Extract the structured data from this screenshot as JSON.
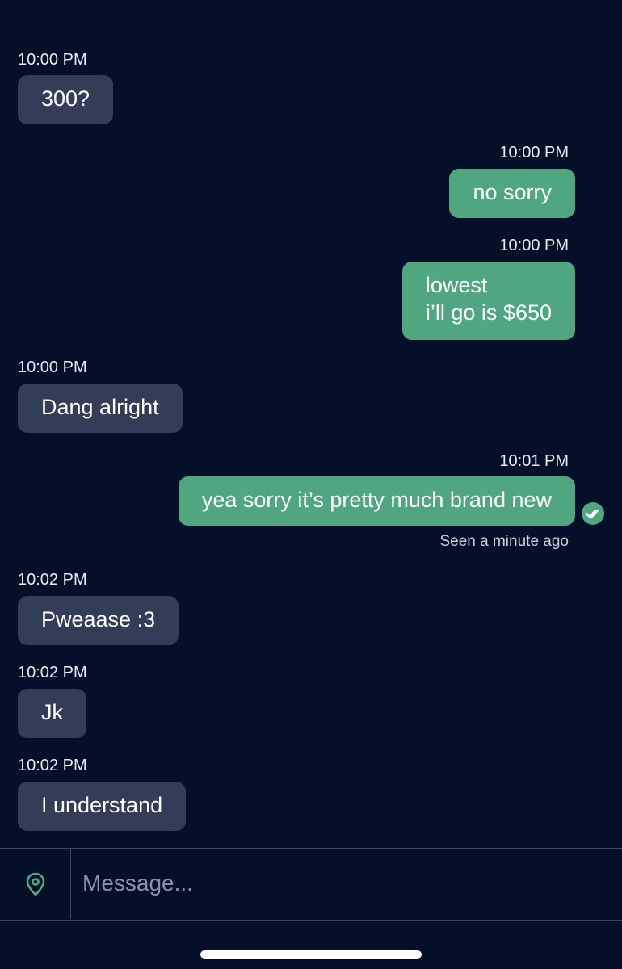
{
  "messages": [
    {
      "time": "10:00 PM",
      "direction": "in",
      "lines": [
        "300?"
      ]
    },
    {
      "time": "10:00 PM",
      "direction": "out",
      "lines": [
        "no sorry"
      ]
    },
    {
      "time": "10:00 PM",
      "direction": "out",
      "lines": [
        "lowest",
        "i’ll go is $650"
      ]
    },
    {
      "time": "10:00 PM",
      "direction": "in",
      "lines": [
        "Dang alright"
      ]
    },
    {
      "time": "10:01 PM",
      "direction": "out",
      "lines": [
        "yea sorry it’s pretty much brand new"
      ],
      "status": "Seen a minute ago"
    },
    {
      "time": "10:02 PM",
      "direction": "in",
      "lines": [
        "Pweaase :3"
      ]
    },
    {
      "time": "10:02 PM",
      "direction": "in",
      "lines": [
        "Jk"
      ]
    },
    {
      "time": "10:02 PM",
      "direction": "in",
      "lines": [
        "I understand"
      ]
    }
  ],
  "composer": {
    "placeholder": "Message...",
    "location_icon": "map-pin-icon"
  },
  "icons": {
    "read_receipt": "double-check-icon"
  },
  "colors": {
    "background": "#04102a",
    "incoming_bubble": "#323d57",
    "outgoing_bubble": "#4fa67f",
    "accent": "#4fa67f"
  }
}
